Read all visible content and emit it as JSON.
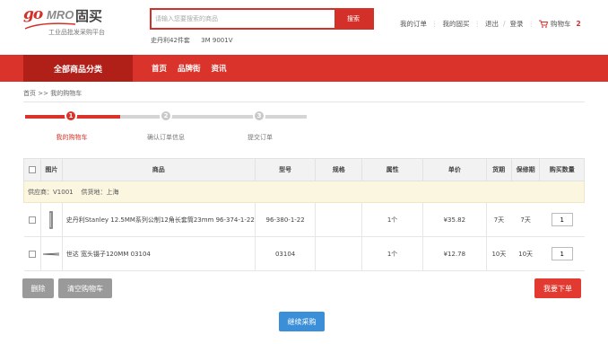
{
  "logo": {
    "go": "go",
    "mro": "MRO",
    "cn": "固买",
    "slogan": "工业品批发采购平台"
  },
  "search": {
    "placeholder": "请输入您要搜索的商品",
    "button": "搜索",
    "hot": [
      "史丹利42件套",
      "3M 9001V"
    ]
  },
  "top_links": {
    "orders": "我的订单",
    "my_gumai": "我的固买",
    "logout": "退出",
    "login": "登录",
    "cart": "购物车",
    "cart_count": "2"
  },
  "nav": {
    "all_categories": "全部商品分类",
    "items": [
      "首页",
      "品牌街",
      "资讯"
    ]
  },
  "breadcrumb": {
    "home": "首页",
    "sep": ">>",
    "current": "我的购物车"
  },
  "steps": [
    {
      "num": "1",
      "label": "我的购物车"
    },
    {
      "num": "2",
      "label": "确认订单信息"
    },
    {
      "num": "3",
      "label": "提交订单"
    }
  ],
  "table": {
    "headers": [
      "图片",
      "商品",
      "型号",
      "规格",
      "属性",
      "单价",
      "货期",
      "保修期",
      "购买数量"
    ],
    "supplier": {
      "label": "供应商：V1001",
      "origin": "供货地：上海"
    },
    "rows": [
      {
        "name": "史丹利Stanley 12.5MM系列公制12角长套筒23mm 96-374-1-22",
        "model": "96-380-1-22",
        "spec": "",
        "attr": "1个",
        "price": "¥35.82",
        "delivery": "7天",
        "warranty": "7天",
        "qty": "1"
      },
      {
        "name": "世达 宽头镊子120MM 03104",
        "model": "03104",
        "spec": "",
        "attr": "1个",
        "price": "¥12.78",
        "delivery": "10天",
        "warranty": "10天",
        "qty": "1"
      }
    ]
  },
  "buttons": {
    "delete": "删除",
    "clear": "清空购物车",
    "order": "我要下单",
    "continue": "继续采购"
  },
  "colors": {
    "brand_red": "#d9332b",
    "dark_red": "#b02019",
    "blue": "#3b8fd8",
    "gray": "#9a9a9a"
  }
}
